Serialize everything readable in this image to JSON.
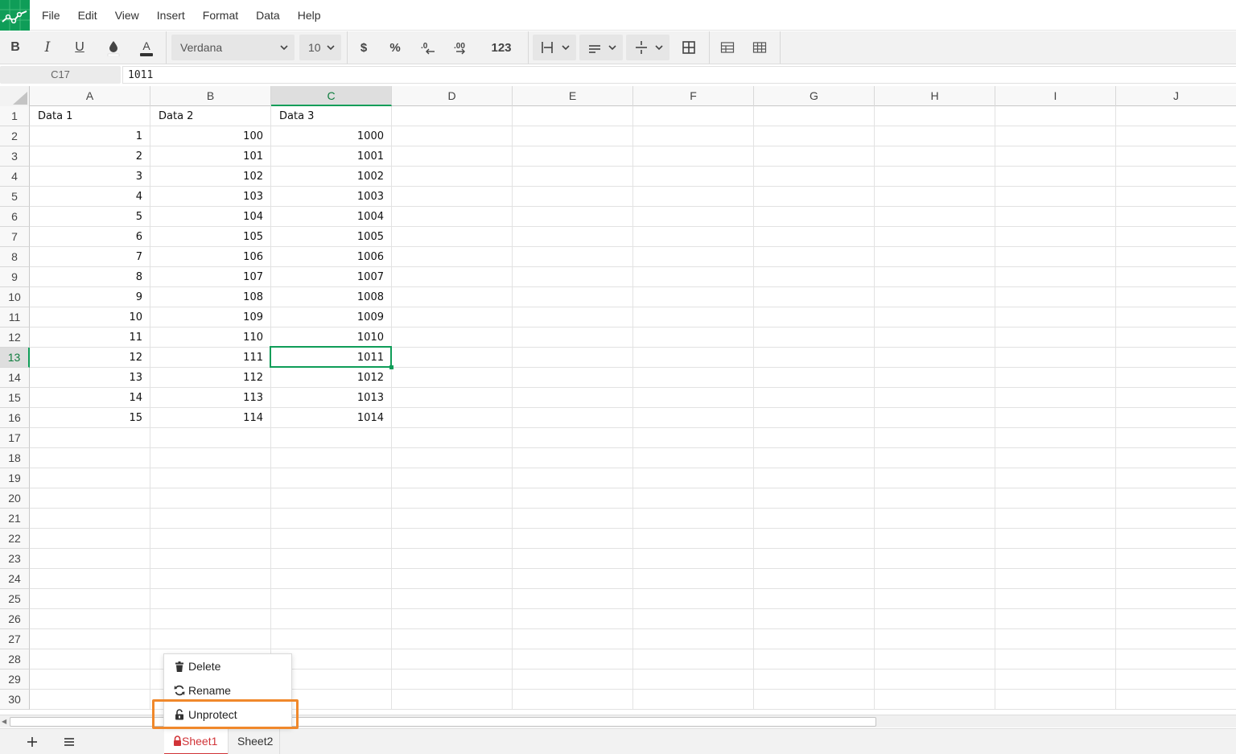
{
  "menubar": {
    "items": [
      "File",
      "Edit",
      "View",
      "Insert",
      "Format",
      "Data",
      "Help"
    ]
  },
  "toolbar": {
    "bold": "B",
    "italic": "I",
    "underline": "U",
    "font_family": "Verdana",
    "font_size": "10",
    "currency": "$",
    "percent": "%",
    "decimal_decrease": ".0",
    "decimal_increase": ".00",
    "number_format": "123"
  },
  "formula_bar": {
    "name_box": "C17",
    "value": "1011"
  },
  "grid": {
    "columns": [
      "A",
      "B",
      "C",
      "D",
      "E",
      "F",
      "G",
      "H",
      "I",
      "J"
    ],
    "selected_column": "C",
    "row_numbers": [
      "1",
      "2",
      "3",
      "4",
      "5",
      "6",
      "7",
      "8",
      "9",
      "10",
      "11",
      "12",
      "13",
      "14",
      "15",
      "16",
      "17",
      "18",
      "19",
      "20",
      "21",
      "22",
      "23",
      "24",
      "25",
      "26",
      "27",
      "28",
      "29",
      "30"
    ],
    "selected_row": "13",
    "headers": [
      "Data 1",
      "Data 2",
      "Data 3"
    ],
    "rows": [
      [
        "1",
        "100",
        "1000"
      ],
      [
        "2",
        "101",
        "1001"
      ],
      [
        "3",
        "102",
        "1002"
      ],
      [
        "4",
        "103",
        "1003"
      ],
      [
        "5",
        "104",
        "1004"
      ],
      [
        "6",
        "105",
        "1005"
      ],
      [
        "7",
        "106",
        "1006"
      ],
      [
        "8",
        "107",
        "1007"
      ],
      [
        "9",
        "108",
        "1008"
      ],
      [
        "10",
        "109",
        "1009"
      ],
      [
        "11",
        "110",
        "1010"
      ],
      [
        "12",
        "111",
        "1011"
      ],
      [
        "13",
        "112",
        "1012"
      ],
      [
        "14",
        "113",
        "1013"
      ],
      [
        "15",
        "114",
        "1014"
      ]
    ]
  },
  "context_menu": {
    "items": [
      {
        "label": "Delete",
        "icon": "trash-icon"
      },
      {
        "label": "Rename",
        "icon": "refresh-icon"
      },
      {
        "label": "Unprotect",
        "icon": "unlock-icon"
      }
    ]
  },
  "sheets": {
    "tabs": [
      "Sheet1",
      "Sheet2"
    ],
    "active": "Sheet1"
  },
  "colors": {
    "brand": "#0f9d58",
    "active_tab": "#d13438",
    "highlight": "#f0882b"
  }
}
